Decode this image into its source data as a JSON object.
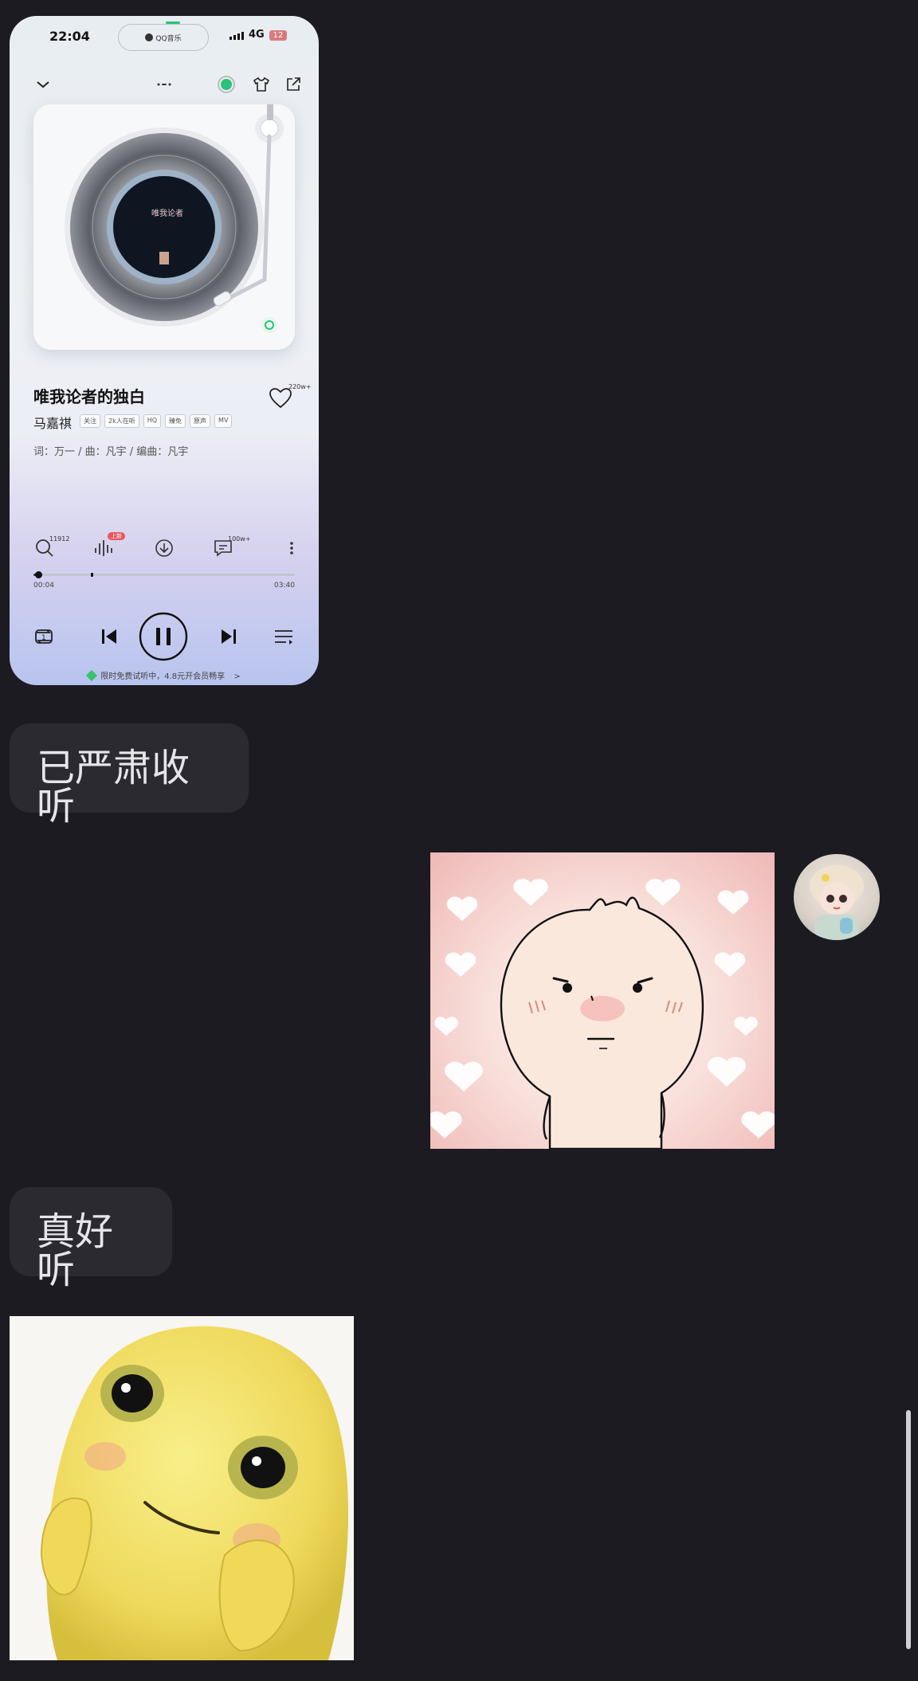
{
  "music_card": {
    "status_time": "22:04",
    "island_label": "QQ音乐",
    "network": "4G",
    "battery": "12",
    "song_title": "唯我论者的独白",
    "likes": "220w+",
    "artist": "马嘉祺",
    "tags": [
      "关注",
      "2k人在听",
      "HQ",
      "臻免",
      "原声",
      "MV"
    ],
    "credits": "词：万一 / 曲：凡宇 / 编曲：凡宇",
    "actions": {
      "search_count": "11912",
      "effect_badge": "上新",
      "comments_count": "100w+"
    },
    "time_current": "00:04",
    "time_total": "03:40",
    "progress_fraction": 0.018,
    "trial_text": "限时免费试听中，4.8元开会员畅享",
    "trial_arrow": ">",
    "accent_color": "#2ac27a"
  },
  "messages": [
    {
      "side": "incoming",
      "type": "text",
      "text": "已严肃收听"
    },
    {
      "side": "outgoing",
      "type": "sticker",
      "sticker": "blushing-bun-hearts"
    },
    {
      "side": "incoming",
      "type": "text",
      "text": "真好听"
    },
    {
      "side": "incoming",
      "type": "sticker",
      "sticker": "yellow-blob-shy"
    }
  ],
  "colors": {
    "background": "#1c1b21",
    "bubble": "#2b2a31",
    "bubble_text": "#e6e6ea"
  }
}
